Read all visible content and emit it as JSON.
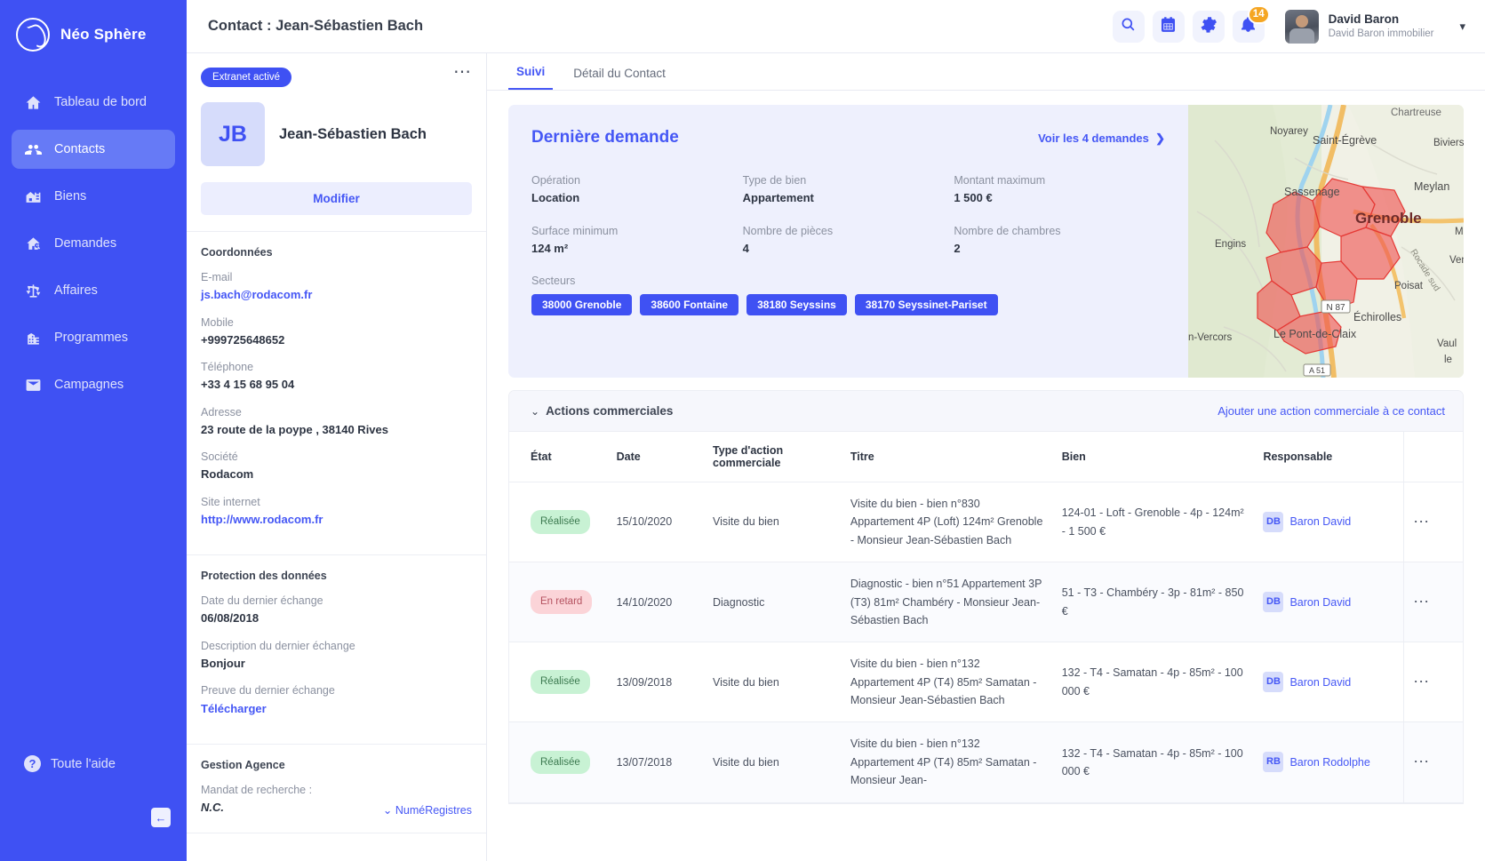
{
  "brand": {
    "name": "Néo Sphère",
    "logo_icon": "sphere-logo-icon"
  },
  "sidebar": {
    "items": [
      {
        "label": "Tableau de bord",
        "icon": "home-icon",
        "active": false
      },
      {
        "label": "Contacts",
        "icon": "people-icon",
        "active": true
      },
      {
        "label": "Biens",
        "icon": "building-icon",
        "active": false
      },
      {
        "label": "Demandes",
        "icon": "house-search-icon",
        "active": false
      },
      {
        "label": "Affaires",
        "icon": "scales-icon",
        "active": false
      },
      {
        "label": "Programmes",
        "icon": "city-icon",
        "active": false
      },
      {
        "label": "Campagnes",
        "icon": "mail-icon",
        "active": false
      }
    ],
    "help_label": "Toute l'aide",
    "help_icon": "question-mark-icon",
    "collapse_icon": "arrow-left-icon"
  },
  "header": {
    "title": "Contact : Jean-Sébastien Bach",
    "icons": [
      {
        "name": "search-icon"
      },
      {
        "name": "calendar-icon"
      },
      {
        "name": "gear-icon"
      },
      {
        "name": "bell-icon",
        "badge": "14"
      }
    ],
    "user": {
      "name": "David Baron",
      "org": "David Baron immobilier",
      "chevron": "chevron-down-icon"
    }
  },
  "contact_panel": {
    "extranet_badge": "Extranet activé",
    "more_icon": "ellipsis-icon",
    "initials": "JB",
    "name": "Jean-Sébastien Bach",
    "edit_label": "Modifier",
    "coordonnees": {
      "title": "Coordonnées",
      "fields": [
        {
          "label": "E-mail",
          "value": "js.bach@rodacom.fr",
          "link": true
        },
        {
          "label": "Mobile",
          "value": "+999725648652",
          "link": false
        },
        {
          "label": "Téléphone",
          "value": "+33 4 15 68 95 04",
          "link": false
        },
        {
          "label": "Adresse",
          "value": "23 route de la poype , 38140 Rives",
          "link": false
        },
        {
          "label": "Société",
          "value": "Rodacom",
          "link": false
        },
        {
          "label": "Site internet",
          "value": "http://www.rodacom.fr",
          "link": true
        }
      ]
    },
    "protection": {
      "title": "Protection des données",
      "fields": [
        {
          "label": "Date du dernier échange",
          "value": "06/08/2018",
          "link": false
        },
        {
          "label": "Description du dernier échange",
          "value": "Bonjour",
          "link": false
        },
        {
          "label": "Preuve du dernier échange",
          "value": "Télécharger",
          "link": true
        }
      ]
    },
    "gestion": {
      "title": "Gestion Agence",
      "mandat_label": "Mandat de recherche :",
      "mandat_value": "N.C.",
      "numregistre_label": "NuméRegistres",
      "numregistre_caret": "chevron-down-icon"
    }
  },
  "tabs": [
    {
      "label": "Suivi",
      "active": true
    },
    {
      "label": "Détail du Contact",
      "active": false
    }
  ],
  "demande": {
    "title": "Dernière demande",
    "voir_link": "Voir les 4 demandes",
    "voir_chevron": "chevron-right-icon",
    "fields": [
      {
        "label": "Opération",
        "value": "Location"
      },
      {
        "label": "Type de bien",
        "value": "Appartement"
      },
      {
        "label": "Montant maximum",
        "value": "1 500 €"
      },
      {
        "label": "Surface minimum",
        "value": "124 m²"
      },
      {
        "label": "Nombre de pièces",
        "value": "4"
      },
      {
        "label": "Nombre de chambres",
        "value": "2"
      }
    ],
    "secteurs_label": "Secteurs",
    "secteurs": [
      "38000 Grenoble",
      "38600 Fontaine",
      "38180 Seyssins",
      "38170 Seyssinet-Pariset"
    ],
    "map": {
      "labels": [
        "Noyarey",
        "Saint-Égrève",
        "Chartreuse",
        "Biviers",
        "Sassenage",
        "Meylan",
        "Grenoble",
        "Engins",
        "Rocade sud",
        "Ven",
        "Poisat",
        "N 87",
        "Échirolles",
        "n-Vercors",
        "Le Pont-de-Claix",
        "Vaul",
        "le",
        "A 51",
        "M"
      ],
      "highlight_color": "#ef5350"
    }
  },
  "actions": {
    "section_title": "Actions commerciales",
    "collapse_caret": "chevron-down-icon",
    "add_link": "Ajouter une action commerciale à ce contact",
    "columns": [
      "État",
      "Date",
      "Type d'action commerciale",
      "Titre",
      "Bien",
      "Responsable",
      ""
    ],
    "rows": [
      {
        "status": "Réalisée",
        "status_kind": "ok",
        "date": "15/10/2020",
        "type": "Visite du bien",
        "titre": "Visite du bien - bien n°830 Appartement 4P (Loft) 124m² Grenoble - Monsieur Jean-Sébastien Bach",
        "bien": "124-01 - Loft - Grenoble - 4p - 124m² - 1 500 €",
        "resp_initials": "DB",
        "resp_name": "Baron David",
        "row_menu_icon": "ellipsis-icon"
      },
      {
        "status": "En retard",
        "status_kind": "late",
        "date": "14/10/2020",
        "type": "Diagnostic",
        "titre": "Diagnostic - bien n°51 Appartement 3P (T3) 81m² Chambéry - Monsieur Jean-Sébastien Bach",
        "bien": "51 - T3 - Chambéry - 3p - 81m² - 850 €",
        "resp_initials": "DB",
        "resp_name": "Baron David",
        "row_menu_icon": "ellipsis-icon"
      },
      {
        "status": "Réalisée",
        "status_kind": "ok",
        "date": "13/09/2018",
        "type": "Visite du bien",
        "titre": "Visite du bien - bien n°132 Appartement 4P (T4) 85m² Samatan - Monsieur Jean-Sébastien Bach",
        "bien": "132 - T4 - Samatan - 4p - 85m² - 100 000 €",
        "resp_initials": "DB",
        "resp_name": "Baron David",
        "row_menu_icon": "ellipsis-icon"
      },
      {
        "status": "Réalisée",
        "status_kind": "ok",
        "date": "13/07/2018",
        "type": "Visite du bien",
        "titre": "Visite du bien - bien n°132 Appartement 4P (T4) 85m² Samatan - Monsieur Jean-",
        "bien": "132 - T4 - Samatan - 4p - 85m² - 100 000 €",
        "resp_initials": "RB",
        "resp_name": "Baron Rodolphe",
        "row_menu_icon": "ellipsis-icon"
      }
    ]
  },
  "colors": {
    "brand": "#3f51f3",
    "link": "#4557f5",
    "ok": "#c8f2d4",
    "late": "#fbd4d8",
    "accent_badge": "#f5a623"
  }
}
